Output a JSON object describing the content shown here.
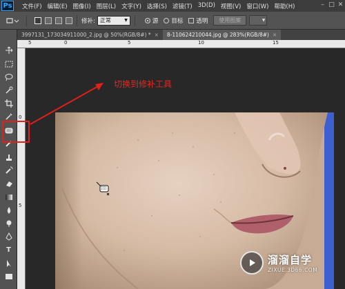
{
  "app": {
    "logo_text": "Ps"
  },
  "menu": {
    "items": [
      "文件(F)",
      "编辑(E)",
      "图像(I)",
      "图层(L)",
      "文字(Y)",
      "选择(S)",
      "滤镜(T)",
      "3D(D)",
      "视图(V)",
      "窗口(W)",
      "帮助(H)"
    ]
  },
  "window_controls": [
    "–",
    "□",
    "✕"
  ],
  "options_bar": {
    "patch_label": "修补:",
    "patch_mode": "正常",
    "source_label": "源",
    "target_label": "目标",
    "transparent_label": "透明",
    "use_pattern_label": "使用图案"
  },
  "tabs": [
    {
      "title": "3997131_173034911000_2.jpg @ 50%(RGB/8#) *",
      "close": "×",
      "active": false
    },
    {
      "title": "8-110624210044.jpg @ 283%(RGB/8#)",
      "close": "×",
      "active": true
    }
  ],
  "ruler": {
    "top_labels": [
      "5",
      "0",
      "5",
      "10",
      "15"
    ],
    "left_labels": [
      "0",
      "5"
    ]
  },
  "annotation": {
    "text": "切换到修补工具",
    "color": "#e8271f"
  },
  "watermark": {
    "title": "溜溜自学",
    "subtitle": "ZIXUE.3D66.COM"
  },
  "tools": [
    "move-tool",
    "marquee-tool",
    "lasso-tool",
    "quick-selection-tool",
    "crop-tool",
    "eyedropper-tool",
    "patch-tool",
    "brush-tool",
    "clone-stamp-tool",
    "history-brush-tool",
    "eraser-tool",
    "gradient-tool",
    "blur-tool",
    "dodge-tool",
    "pen-tool",
    "type-tool",
    "path-selection-tool",
    "shape-tool"
  ],
  "colors": {
    "accent_red": "#e0201b",
    "ps_blue": "#31a8ff",
    "panel": "#535353"
  }
}
